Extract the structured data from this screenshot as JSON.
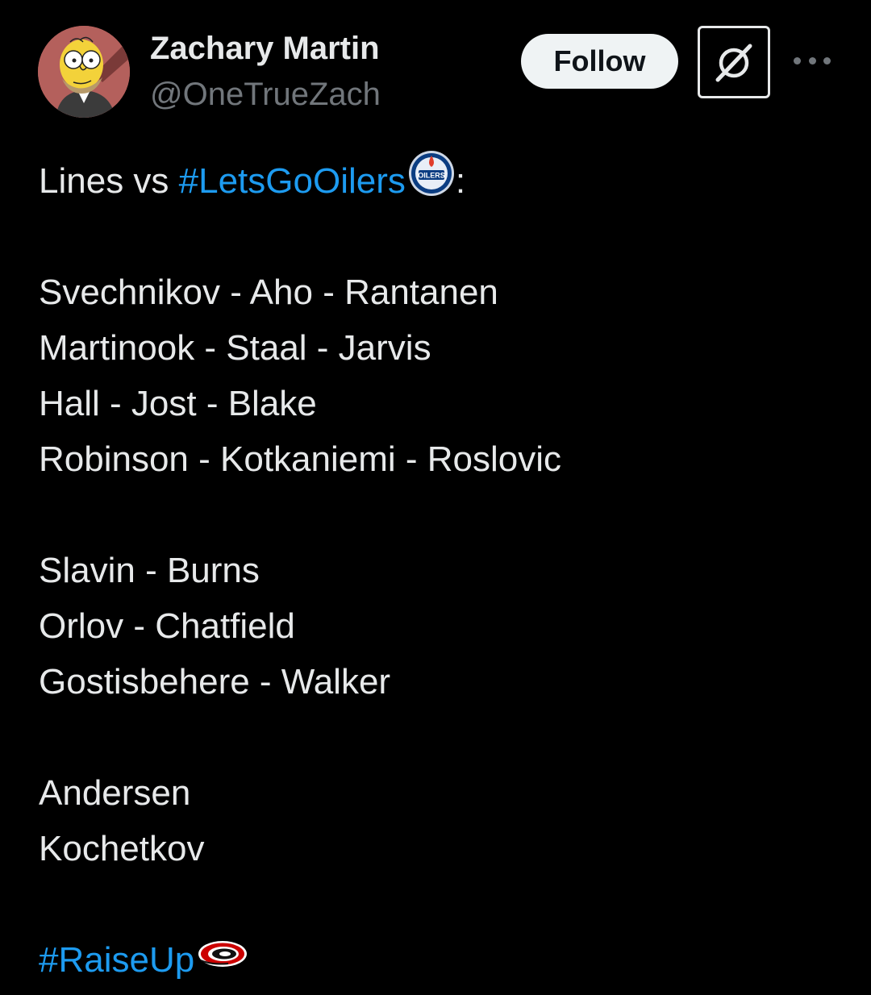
{
  "author": {
    "display_name": "Zachary Martin",
    "handle": "@OneTrueZach",
    "avatar_icon": "homer-simpson-avatar"
  },
  "actions": {
    "follow_label": "Follow",
    "grok_icon": "grok-icon",
    "more_icon": "more-dots-icon"
  },
  "tweet": {
    "intro_text": "Lines vs ",
    "intro_hashtag": "#LetsGoOilers",
    "intro_emoji": "oilers-logo-emoji",
    "intro_suffix": ":",
    "forward_lines": [
      "Svechnikov - Aho - Rantanen",
      "Martinook - Staal - Jarvis",
      "Hall - Jost - Blake",
      "Robinson - Kotkaniemi - Roslovic"
    ],
    "defense_pairs": [
      "Slavin - Burns",
      "Orlov - Chatfield",
      "Gostisbehere - Walker"
    ],
    "goalies": [
      "Andersen",
      "Kochetkov"
    ],
    "closing_hashtag": "#RaiseUp",
    "closing_emoji": "hurricanes-logo-emoji"
  },
  "colors": {
    "background": "#000000",
    "text": "#e7e9ea",
    "secondary_text": "#71767b",
    "link": "#1d9bf0",
    "follow_bg": "#eff3f4"
  }
}
